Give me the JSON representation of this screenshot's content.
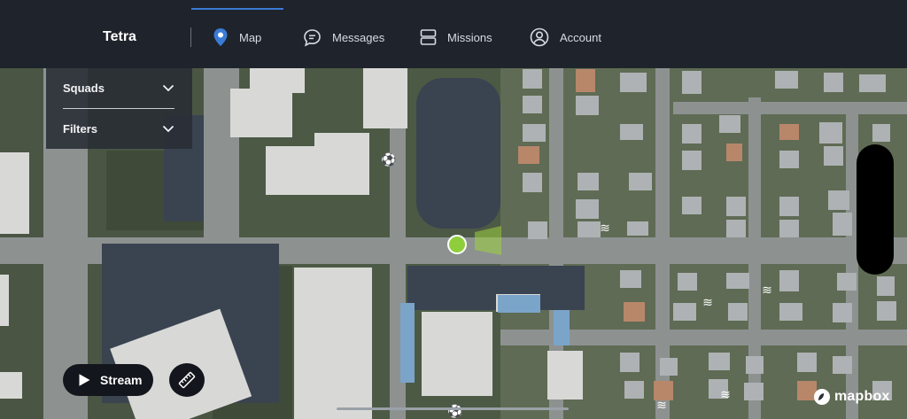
{
  "app": {
    "title": "Tetra"
  },
  "nav": {
    "items": [
      {
        "label": "Map",
        "icon": "map-pin-icon",
        "active": true
      },
      {
        "label": "Messages",
        "icon": "chat-bubble-icon",
        "active": false
      },
      {
        "label": "Missions",
        "icon": "missions-icon",
        "active": false
      },
      {
        "label": "Account",
        "icon": "account-circle-icon",
        "active": false
      }
    ]
  },
  "panel": {
    "squads_label": "Squads",
    "filters_label": "Filters"
  },
  "controls": {
    "stream_label": "Stream",
    "ruler_icon": "ruler-icon"
  },
  "map": {
    "attribution": "mapbox",
    "colors": {
      "accent": "#3a7bd5",
      "marker": "#8fce3b",
      "navbar": "#1f232b"
    }
  }
}
